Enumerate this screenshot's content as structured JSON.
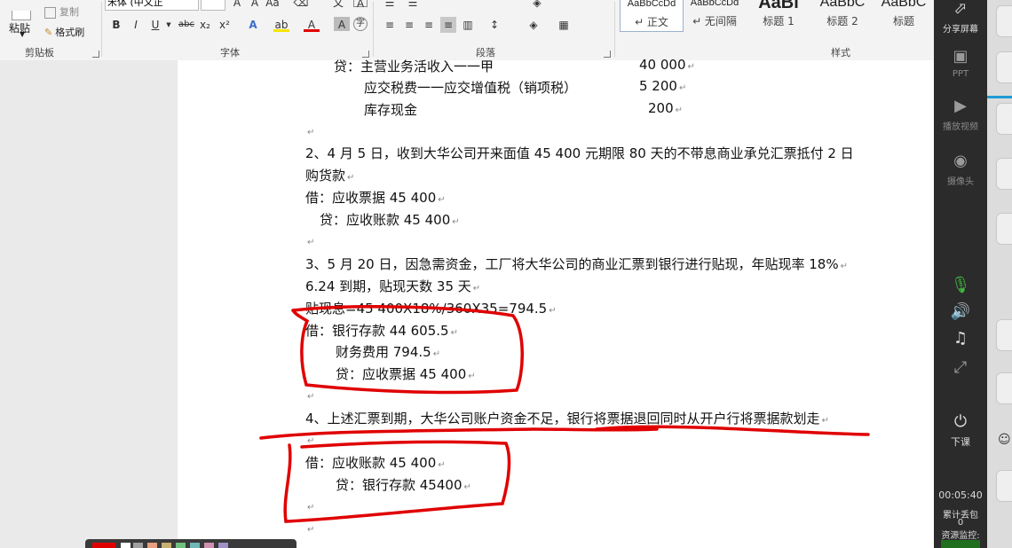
{
  "ribbon": {
    "clipboard": {
      "paste": "粘贴",
      "copy": "复制",
      "format_painter": "格式刷",
      "label": "剪贴板"
    },
    "font": {
      "font_name": "宋体 (中文正",
      "label": "字体",
      "bold": "B",
      "italic": "I",
      "underline": "U",
      "strike": "abc",
      "sub": "x₂",
      "sup": "x²"
    },
    "paragraph": {
      "label": "段落"
    },
    "styles": {
      "label": "样式",
      "items": [
        {
          "sample": "AaBbCcDd",
          "name": "↵ 正文"
        },
        {
          "sample": "AaBbCcDd",
          "name": "↵ 无间隔"
        },
        {
          "sample": "AaBl",
          "name": "标题 1"
        },
        {
          "sample": "AaBbC",
          "name": "标题 2"
        },
        {
          "sample": "AaBbC",
          "name": "标题"
        }
      ]
    }
  },
  "document": {
    "lines": [
      {
        "text": "贷：主营业务活收入一一甲",
        "amount": "40 000"
      },
      {
        "text": "应交税费一一应交增值税（销项税）",
        "amount": "5 200"
      },
      {
        "text": "库存现金",
        "amount": "200"
      },
      {
        "text": ""
      },
      {
        "text": "2、4 月 5 日，收到大华公司开来面值 45 400 元期限 80 天的不带息商业承兑汇票抵付 2 日"
      },
      {
        "text": "购货款"
      },
      {
        "text": "借：应收票据        45 400"
      },
      {
        "text": "贷：应收账款        45 400"
      },
      {
        "text": ""
      },
      {
        "text": "3、5 月 20 日，因急需资金，工厂将大华公司的商业汇票到银行进行贴现，年贴现率 18%"
      },
      {
        "text": "6.24 到期，贴现天数 35 天"
      },
      {
        "text": "贴现息=45 400X18%/360X35=794.5"
      },
      {
        "text": "借：银行存款          44 605.5"
      },
      {
        "text": "财务费用          794.5"
      },
      {
        "text": "贷：应收票据    45 400"
      },
      {
        "text": ""
      },
      {
        "text": "4、上述汇票到期，大华公司账户资金不足，银行将票据退回同时从开户行将票据款划走"
      },
      {
        "text": ""
      },
      {
        "text": "借：应收账款    45 400"
      },
      {
        "text": "贷：银行存款    45400"
      },
      {
        "text": ""
      },
      {
        "text": ""
      }
    ]
  },
  "sidebar": {
    "share": "分享屏幕",
    "ppt": "PPT",
    "video": "播放视频",
    "camera": "摄像头",
    "leave": "下课",
    "timer": "00:05:40",
    "sent_label": "累计丢包",
    "sent_value": "0",
    "monitor": "资源监控:"
  },
  "colors": {
    "annotation": "#e00000",
    "ribbon_bg": "#f3f3f3",
    "sidebar_bg": "#2b2b2b"
  }
}
